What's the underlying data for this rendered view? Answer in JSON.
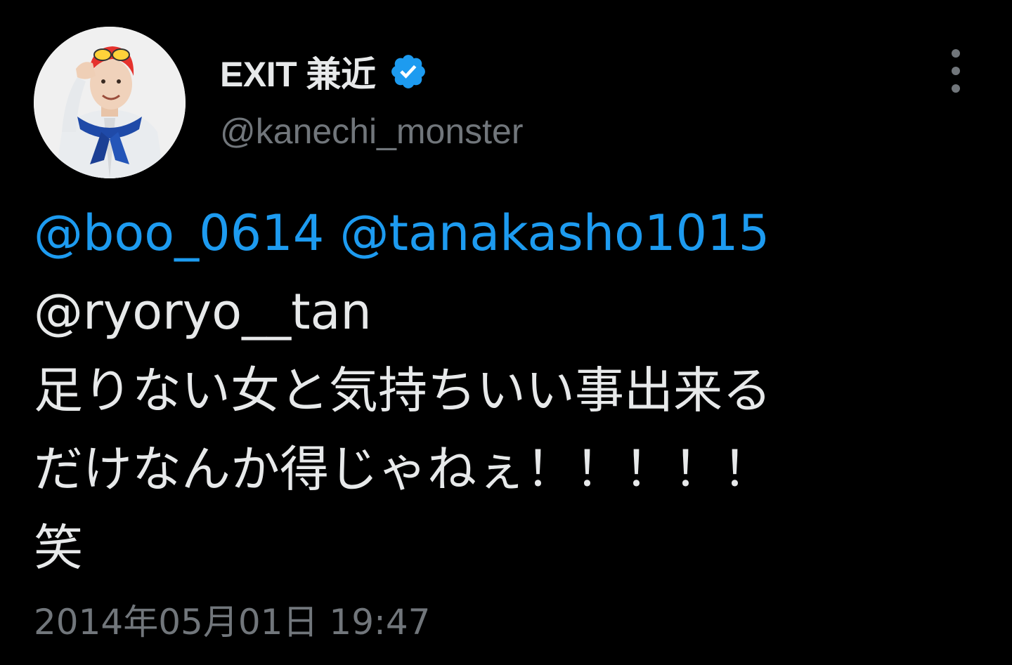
{
  "tweet": {
    "author": {
      "display_name": "EXIT 兼近",
      "handle": "@kanechi_monster",
      "verified": true,
      "verified_icon": "verified-badge-icon",
      "avatar": "profile-photo"
    },
    "more_icon": "more-options-vertical-icon",
    "mentions": [
      "@boo_0614",
      "@tanakasho1015",
      "@ryoryo__tan"
    ],
    "text_lines": [
      "足りない女と気持ちいい事出来る",
      "だけなんか得じゃねぇ！！！！！",
      "笑"
    ],
    "timestamp": "2014年05月01日 19:47"
  },
  "colors": {
    "background": "#000000",
    "primary_text": "#e7e9ea",
    "secondary_text": "#71767b",
    "link": "#1d9bf0",
    "verified": "#1d9bf0"
  }
}
